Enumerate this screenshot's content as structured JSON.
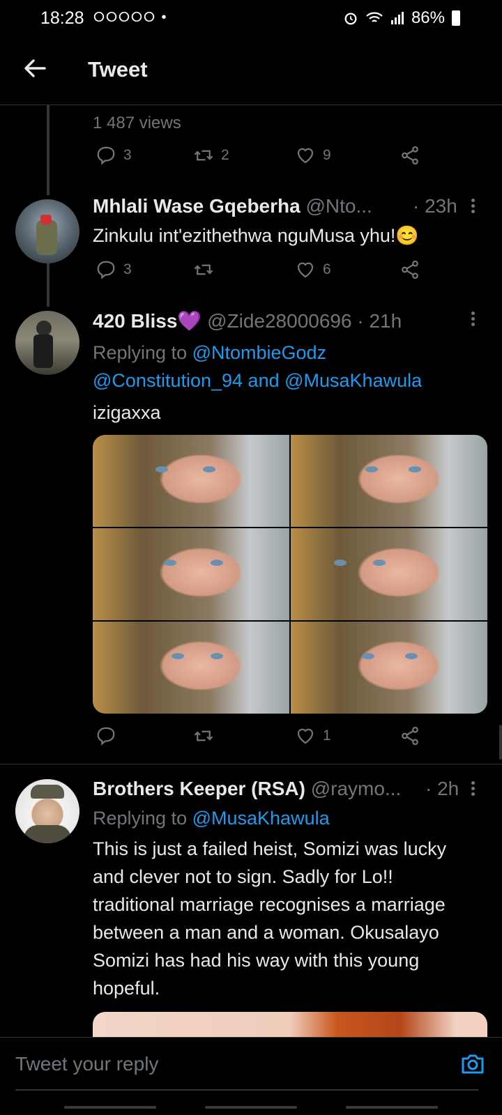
{
  "status_bar": {
    "time": "18:28",
    "notification_icons": "⭘⭘⭘⭘⭘ •",
    "battery": "86%"
  },
  "header": {
    "title": "Tweet",
    "back_icon": "arrow-left-icon"
  },
  "prev_tweet": {
    "views": "1 487 views",
    "replies": "3",
    "retweets": "2",
    "likes": "9"
  },
  "tweets": [
    {
      "name": "Mhlali Wase Gqeberha",
      "handle": "@Nto...",
      "time": "· 23h",
      "text": "Zinkulu int'ezithethwa nguMusa yhu!😊",
      "replies": "3",
      "retweets": "",
      "likes": "6"
    },
    {
      "name": "420 Bliss💜",
      "handle": "@Zide28000696",
      "time": "· 21h",
      "replying_prefix": "Replying to ",
      "replying_to_1": "@NtombieGodz",
      "replying_to_2": "@Constitution_94",
      "replying_and": " and ",
      "replying_to_3": "@MusaKhawula",
      "text": "izigaxxa",
      "replies": "",
      "retweets": "",
      "likes": "1"
    },
    {
      "name": "Brothers Keeper (RSA)",
      "handle": "@raymo...",
      "time": "· 2h",
      "replying_prefix": "Replying to ",
      "replying_to_1": "@MusaKhawula",
      "text": "This is just a failed heist, Somizi was lucky and clever not to sign. Sadly for Lo!! traditional marriage recognises a marriage between a man and a woman. Okusalayo Somizi has had his way with this young hopeful."
    }
  ],
  "reply_bar": {
    "placeholder": "Tweet your reply",
    "camera_icon": "camera-icon"
  },
  "colors": {
    "accent": "#1d9bf0",
    "muted": "#71767b",
    "background": "#000000"
  }
}
